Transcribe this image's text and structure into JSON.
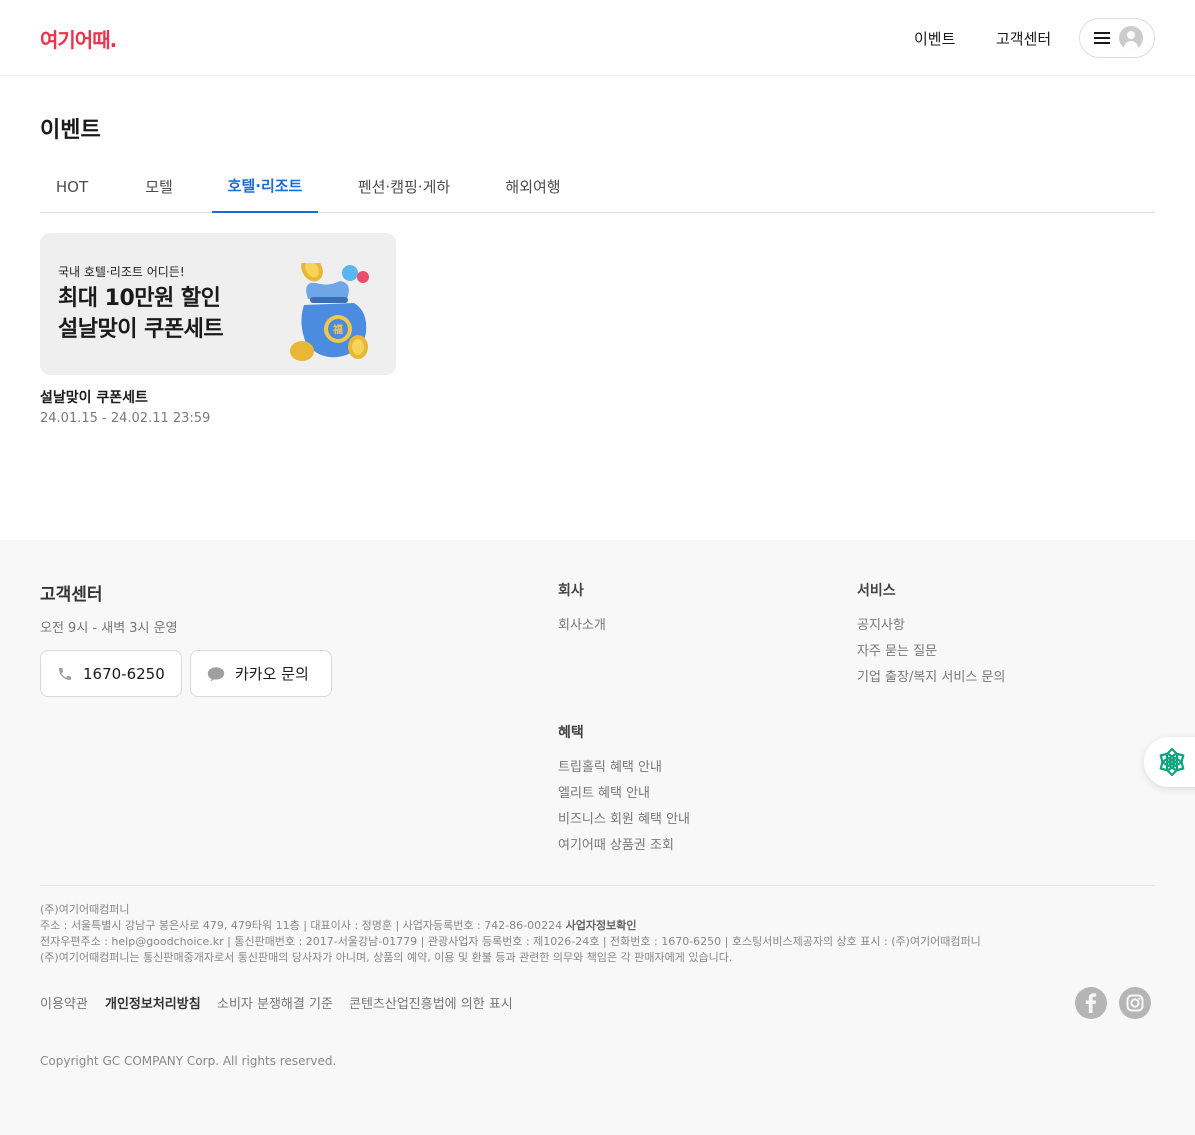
{
  "header": {
    "logo": "여기어때.",
    "nav": {
      "events": "이벤트",
      "customer_center": "고객센터"
    }
  },
  "page": {
    "title": "이벤트"
  },
  "tabs": [
    {
      "label": "HOT",
      "active": false
    },
    {
      "label": "모텔",
      "active": false
    },
    {
      "label": "호텔·리조트",
      "active": true
    },
    {
      "label": "펜션·캠핑·게하",
      "active": false
    },
    {
      "label": "해외여행",
      "active": false
    }
  ],
  "events": [
    {
      "banner_sub": "국내 호텔·리조트 어디든!",
      "banner_line1": "최대 10만원 할인",
      "banner_line2": "설날맞이 쿠폰세트",
      "title": "설날맞이 쿠폰세트",
      "period": "24.01.15 - 24.02.11 23:59"
    }
  ],
  "footer": {
    "cs": {
      "title": "고객센터",
      "hours": "오전 9시 - 새벽 3시 운영",
      "phone": "1670-6250",
      "kakao": "카카오 문의"
    },
    "company": {
      "title": "회사",
      "links": [
        "회사소개"
      ]
    },
    "service": {
      "title": "서비스",
      "links": [
        "공지사항",
        "자주 묻는 질문",
        "기업 출장/복지 서비스 문의"
      ]
    },
    "benefit": {
      "title": "혜택",
      "links": [
        "트립홀릭 혜택 안내",
        "엘리트 혜택 안내",
        "비즈니스 회원 혜택 안내",
        "여기어때 상품권 조회"
      ]
    },
    "biz_info": {
      "line1": "(주)여기어때컴퍼니",
      "line2": "주소 : 서울특별시 강남구 봉은사로 479, 479타워 11층 | 대표이사 : 정명훈 | 사업자등록번호 : 742-86-00224",
      "line2_link": "사업자정보확인",
      "line3": "전자우편주소 : help@goodchoice.kr | 통신판매번호 : 2017-서울강남-01779 | 관광사업자 등록번호 : 제1026-24호 | 전화번호 : 1670-6250 | 호스팅서비스제공자의 상호 표시 : (주)여기어때컴퍼니",
      "line4": "(주)여기어때컴퍼니는 통신판매중개자로서 통신판매의 당사자가 아니며, 상품의 예약, 이용 및 환불 등과 관련한 의무와 책임은 각 판매자에게 있습니다."
    },
    "policies": [
      "이용약관",
      "개인정보처리방침",
      "소비자 분쟁해결 기준",
      "콘텐츠산업진흥법에 의한 표시"
    ],
    "copyright": "Copyright GC COMPANY Corp. All rights reserved."
  },
  "colors": {
    "brand": "#e8344e",
    "active_tab": "#1a6fd4"
  },
  "icons": [
    "hamburger-icon",
    "avatar-icon",
    "phone-icon",
    "chat-icon",
    "facebook-icon",
    "instagram-icon",
    "chatbot-icon"
  ]
}
